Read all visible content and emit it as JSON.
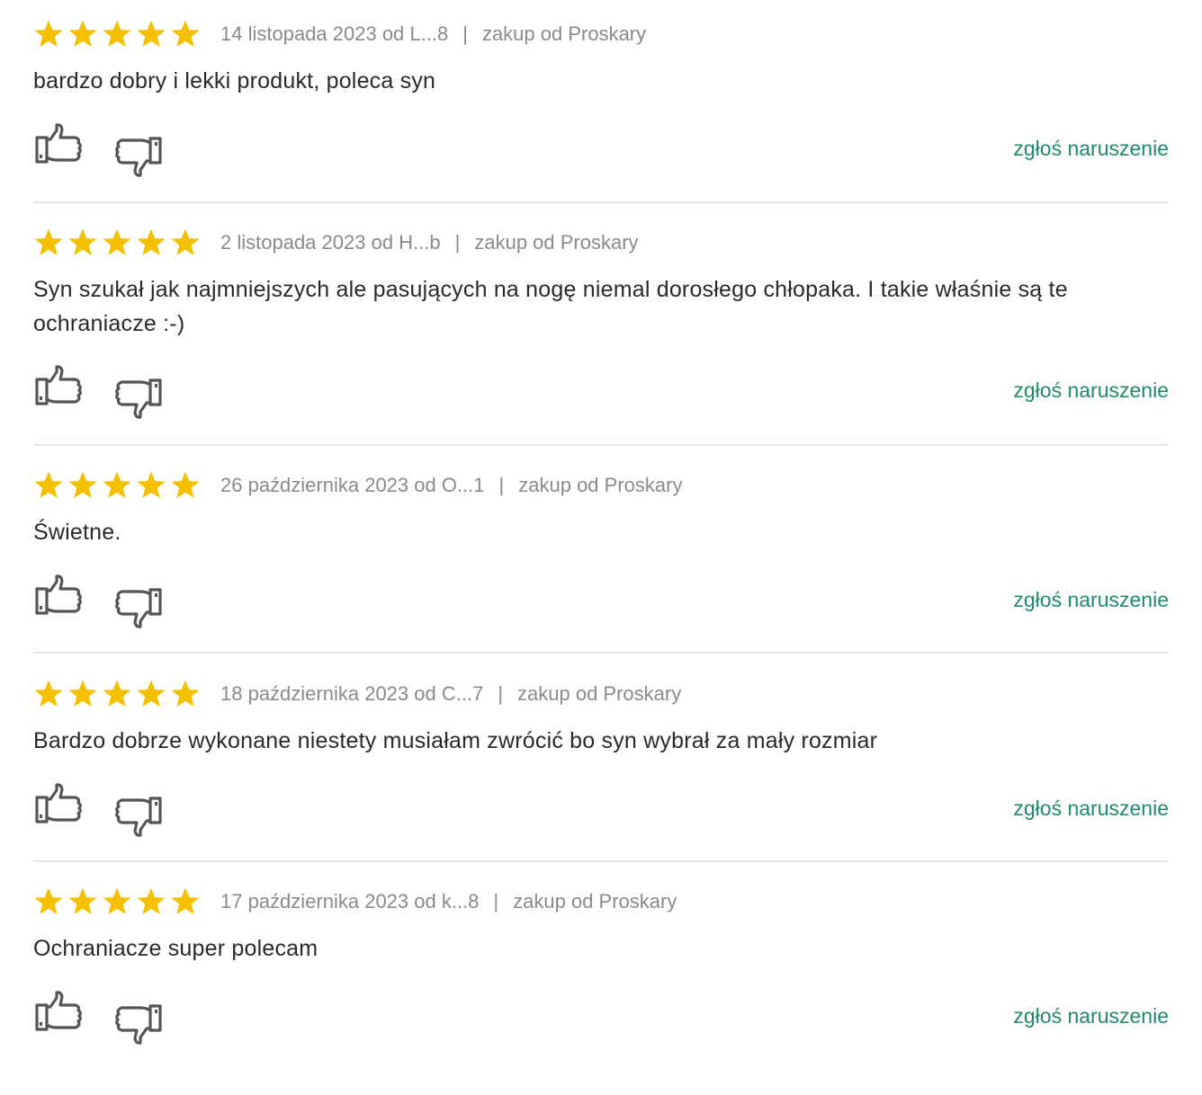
{
  "colors": {
    "star": "#f5c000",
    "meta_text": "#8a8a8a",
    "link": "#1f8a6e",
    "icon_stroke": "#555555",
    "divider": "#e6e6e6"
  },
  "icons": {
    "star": "star-icon",
    "thumbs_up": "thumbs-up-icon",
    "thumbs_down": "thumbs-down-icon"
  },
  "separator": "|",
  "reviews": [
    {
      "rating": 5,
      "date_author": "14 listopada 2023 od L...8",
      "source": "zakup od Proskary",
      "text": "bardzo dobry i lekki produkt, poleca syn",
      "report_label": "zgłoś naruszenie"
    },
    {
      "rating": 5,
      "date_author": "2 listopada 2023 od H...b",
      "source": "zakup od Proskary",
      "text": "Syn szukał jak najmniejszych ale pasujących na nogę niemal dorosłego chłopaka. I takie właśnie są te ochraniacze :-)",
      "report_label": "zgłoś naruszenie"
    },
    {
      "rating": 5,
      "date_author": "26 października 2023 od O...1",
      "source": "zakup od Proskary",
      "text": "Świetne.",
      "report_label": "zgłoś naruszenie"
    },
    {
      "rating": 5,
      "date_author": "18 października 2023 od C...7",
      "source": "zakup od Proskary",
      "text": "Bardzo dobrze wykonane niestety musiałam zwrócić bo syn wybrał za mały rozmiar",
      "report_label": "zgłoś naruszenie"
    },
    {
      "rating": 5,
      "date_author": "17 października 2023 od k...8",
      "source": "zakup od Proskary",
      "text": "Ochraniacze super polecam",
      "report_label": "zgłoś naruszenie"
    }
  ]
}
